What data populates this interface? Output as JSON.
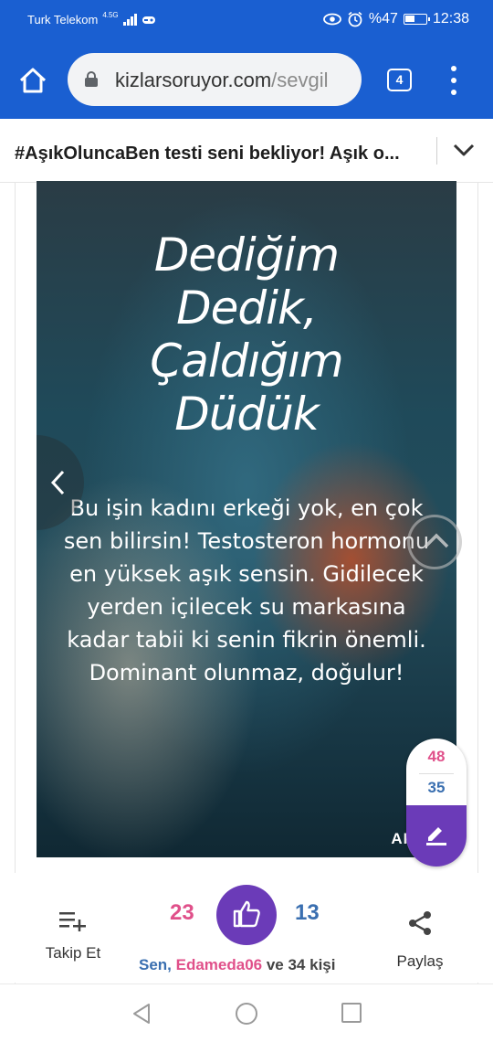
{
  "status_bar": {
    "carrier": "Turk Telekom",
    "network": "4.5G",
    "battery": "%47",
    "time": "12:38"
  },
  "browser": {
    "url_host": "kizlarsoruyor.com",
    "url_path": "/sevgil",
    "tab_count": "4"
  },
  "page": {
    "title": "#AşıkOluncaBen testi seni bekliyor! Aşık o..."
  },
  "hero": {
    "title_lines": [
      "Dediğim",
      "Dedik,",
      "Çaldığım",
      "Düdük"
    ],
    "body": "Bu işin kadını erkeği yok, en çok sen bilirsin! Testosteron hormonu en yüksek aşık sensin. Gidilecek yerden içilecek su markasına kadar tabii ki senin fikrin önemli. Dominant olunmaz, doğulur!",
    "brand": "APEST"
  },
  "votes": {
    "a": "48",
    "b": "35"
  },
  "actions": {
    "follow_label": "Takip Et",
    "up_count": "23",
    "down_count": "13",
    "likers_prefix": "Sen, ",
    "likers_name": "Edameda06",
    "likers_suffix": " ve 34 kişi",
    "share_label": "Paylaş"
  },
  "colors": {
    "brand_blue": "#1a5fd1",
    "accent_purple": "#6b3bb8",
    "pink": "#e0508a",
    "blue": "#3a6fb0"
  }
}
